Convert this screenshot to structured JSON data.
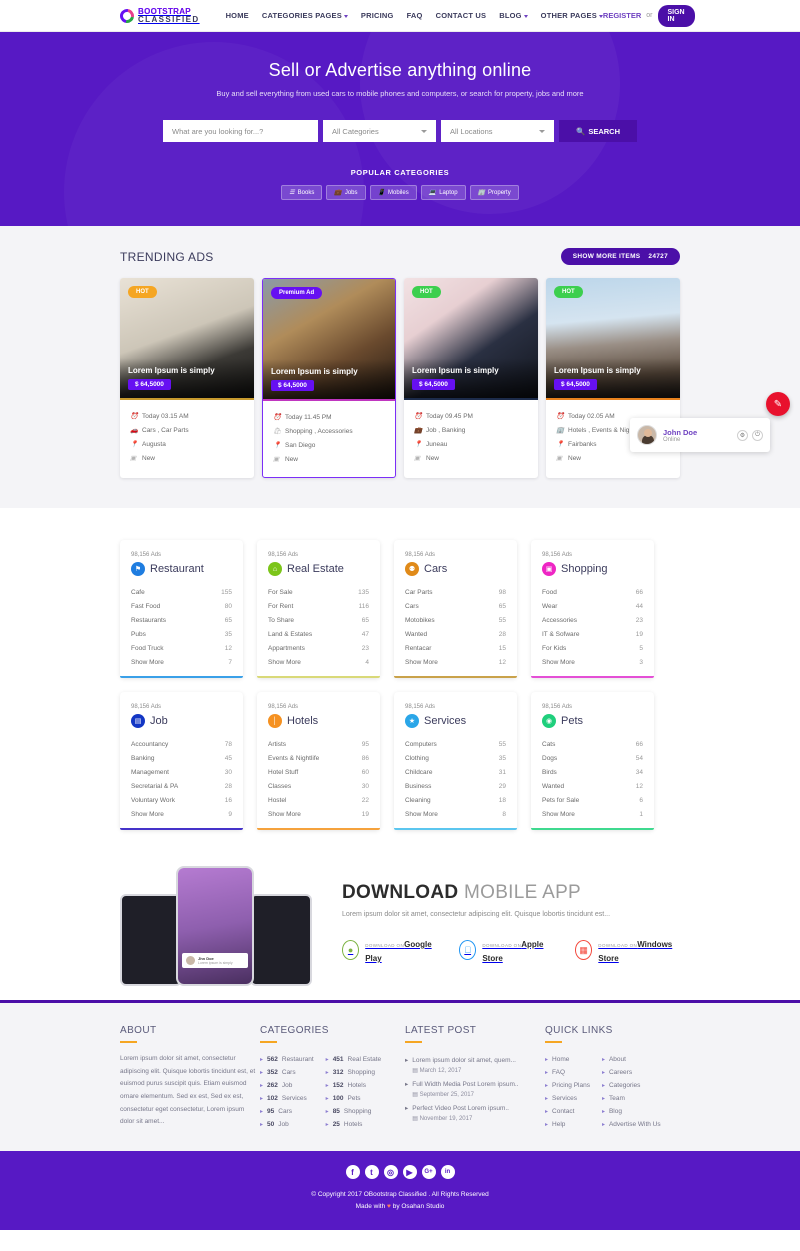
{
  "header": {
    "logo_line1": "BOOTSTRAP",
    "logo_line2": "CLASSIFIED",
    "nav": [
      {
        "label": "HOME",
        "caret": false
      },
      {
        "label": "CATEGORIES PAGES",
        "caret": true
      },
      {
        "label": "PRICING",
        "caret": false
      },
      {
        "label": "FAQ",
        "caret": false
      },
      {
        "label": "CONTACT US",
        "caret": false
      },
      {
        "label": "BLOG",
        "caret": true
      },
      {
        "label": "OTHER PAGES",
        "caret": true
      }
    ],
    "register_label": "REGISTER",
    "or_label": "or",
    "signin_label": "SIGN IN"
  },
  "hero": {
    "title": "Sell or Advertise anything online",
    "subtitle": "Buy and sell everything from used cars to mobile phones and computers, or search for property, jobs and more",
    "search_placeholder": "What are you looking for...?",
    "category_select": "All Categories",
    "location_select": "All Locations",
    "search_button": "SEARCH",
    "search_icon": "search-icon",
    "popular_title": "POPULAR CATEGORIES",
    "pills": [
      {
        "label": "Books",
        "icon": "book-icon"
      },
      {
        "label": "Jobs",
        "icon": "briefcase-icon"
      },
      {
        "label": "Mobiles",
        "icon": "mobile-icon"
      },
      {
        "label": "Laptop",
        "icon": "laptop-icon"
      },
      {
        "label": "Property",
        "icon": "building-icon"
      }
    ]
  },
  "trending": {
    "heading": "TRENDING ADS",
    "show_more_label": "SHOW MORE ITEMS",
    "show_more_count": "24727",
    "cards": [
      {
        "badge": "HOT",
        "badge_type": "hot-orange",
        "featured": false,
        "title": "Lorem Ipsum is simply",
        "price": "$ 64,5000",
        "accent": "#c79a2e",
        "meta": [
          {
            "icon": "clock-icon",
            "text": "Today 03.15 AM"
          },
          {
            "icon": "car-icon",
            "text": "Cars , Car Parts"
          },
          {
            "icon": "pin-icon",
            "text": "Augusta"
          },
          {
            "icon": "tag-icon",
            "text": "New"
          }
        ]
      },
      {
        "badge": "Premium Ad",
        "badge_type": "premium",
        "featured": true,
        "title": "Lorem Ipsum is simply",
        "price": "$ 64,5000",
        "accent": "#c036c0",
        "meta": [
          {
            "icon": "clock-icon",
            "text": "Today 11.45 PM"
          },
          {
            "icon": "bag-icon",
            "text": "Shopping , Accessories"
          },
          {
            "icon": "pin-icon",
            "text": "San Diego"
          },
          {
            "icon": "tag-icon",
            "text": "New"
          }
        ]
      },
      {
        "badge": "HOT",
        "badge_type": "hot-green",
        "featured": false,
        "title": "Lorem Ipsum is simply",
        "price": "$ 64,5000",
        "accent": "#1c2b4a",
        "meta": [
          {
            "icon": "clock-icon",
            "text": "Today 09.45 PM"
          },
          {
            "icon": "briefcase-icon",
            "text": "Job , Banking"
          },
          {
            "icon": "pin-icon",
            "text": "Juneau"
          },
          {
            "icon": "tag-icon",
            "text": "New"
          }
        ]
      },
      {
        "badge": "HOT",
        "badge_type": "hot-green",
        "featured": false,
        "title": "Lorem Ipsum is simply",
        "price": "$ 64,5000",
        "accent": "#e8821e",
        "meta": [
          {
            "icon": "clock-icon",
            "text": "Today 02.05 AM"
          },
          {
            "icon": "building-icon",
            "text": "Hotels , Events & Nig"
          },
          {
            "icon": "pin-icon",
            "text": "Fairbanks"
          },
          {
            "icon": "tag-icon",
            "text": "New"
          }
        ]
      }
    ]
  },
  "categories": [
    {
      "ads": "98,156 Ads",
      "name": "Restaurant",
      "icon": "restaurant-icon",
      "color": "#1f7de0",
      "bar": "#3aa0e8",
      "items": [
        {
          "label": "Cafe",
          "count": "155"
        },
        {
          "label": "Fast Food",
          "count": "80"
        },
        {
          "label": "Restaurants",
          "count": "65"
        },
        {
          "label": "Pubs",
          "count": "35"
        },
        {
          "label": "Food Truck",
          "count": "12"
        },
        {
          "label": "Show More",
          "count": "7"
        }
      ]
    },
    {
      "ads": "98,156 Ads",
      "name": "Real Estate",
      "icon": "home-icon",
      "color": "#7cc51a",
      "bar": "#d9d978",
      "items": [
        {
          "label": "For Sale",
          "count": "135"
        },
        {
          "label": "For Rent",
          "count": "116"
        },
        {
          "label": "To Share",
          "count": "65"
        },
        {
          "label": "Land & Estates",
          "count": "47"
        },
        {
          "label": "Appartments",
          "count": "23"
        },
        {
          "label": "Show More",
          "count": "4"
        }
      ]
    },
    {
      "ads": "98,156 Ads",
      "name": "Cars",
      "icon": "car-icon",
      "color": "#e08a19",
      "bar": "#c9a24a",
      "items": [
        {
          "label": "Car Parts",
          "count": "98"
        },
        {
          "label": "Cars",
          "count": "65"
        },
        {
          "label": "Motobikes",
          "count": "55"
        },
        {
          "label": "Wanted",
          "count": "28"
        },
        {
          "label": "Rentacar",
          "count": "15"
        },
        {
          "label": "Show More",
          "count": "12"
        }
      ]
    },
    {
      "ads": "98,156 Ads",
      "name": "Shopping",
      "icon": "bag-icon",
      "color": "#ee26c4",
      "bar": "#e44fd6",
      "items": [
        {
          "label": "Food",
          "count": "66"
        },
        {
          "label": "Wear",
          "count": "44"
        },
        {
          "label": "Accessories",
          "count": "23"
        },
        {
          "label": "IT & Sofware",
          "count": "19"
        },
        {
          "label": "For Kids",
          "count": "5"
        },
        {
          "label": "Show More",
          "count": "3"
        }
      ]
    },
    {
      "ads": "98,156 Ads",
      "name": "Job",
      "icon": "briefcase-icon",
      "color": "#1336c4",
      "bar": "#4533c9",
      "items": [
        {
          "label": "Accountancy",
          "count": "78"
        },
        {
          "label": "Banking",
          "count": "45"
        },
        {
          "label": "Management",
          "count": "30"
        },
        {
          "label": "Secretarial & PA",
          "count": "28"
        },
        {
          "label": "Voluntary Work",
          "count": "16"
        },
        {
          "label": "Show More",
          "count": "9"
        }
      ]
    },
    {
      "ads": "98,156 Ads",
      "name": "Hotels",
      "icon": "hotel-icon",
      "color": "#f59121",
      "bar": "#f5a23c",
      "items": [
        {
          "label": "Artists",
          "count": "95"
        },
        {
          "label": "Events & Nightlife",
          "count": "86"
        },
        {
          "label": "Hotel Stuff",
          "count": "60"
        },
        {
          "label": "Classes",
          "count": "30"
        },
        {
          "label": "Hostel",
          "count": "22"
        },
        {
          "label": "Show More",
          "count": "19"
        }
      ]
    },
    {
      "ads": "98,156 Ads",
      "name": "Services",
      "icon": "star-icon",
      "color": "#2aa6e8",
      "bar": "#5bc6ef",
      "items": [
        {
          "label": "Computers",
          "count": "55"
        },
        {
          "label": "Clothing",
          "count": "35"
        },
        {
          "label": "Childcare",
          "count": "31"
        },
        {
          "label": "Business",
          "count": "29"
        },
        {
          "label": "Cleaning",
          "count": "18"
        },
        {
          "label": "Show More",
          "count": "8"
        }
      ]
    },
    {
      "ads": "98,156 Ads",
      "name": "Pets",
      "icon": "paw-icon",
      "color": "#1fcf7c",
      "bar": "#3fd98f",
      "items": [
        {
          "label": "Cats",
          "count": "66"
        },
        {
          "label": "Dogs",
          "count": "54"
        },
        {
          "label": "Birds",
          "count": "34"
        },
        {
          "label": "Wanted",
          "count": "12"
        },
        {
          "label": "Pets for Sale",
          "count": "6"
        },
        {
          "label": "Show More",
          "count": "1"
        }
      ]
    }
  ],
  "app": {
    "title_bold": "DOWNLOAD",
    "title_light": "MOBILE APP",
    "desc": "Lorem ipsum dolor sit amet, consectetur adipiscing elit. Quisque lobortis tincidunt est...",
    "stores": [
      {
        "sup": "DOWNLOAD ON",
        "name": "Google Play",
        "icon": "android-icon",
        "color": "#7cb342"
      },
      {
        "sup": "DOWNLOAD ON",
        "name": "Apple Store",
        "icon": "apple-icon",
        "color": "#2196f3"
      },
      {
        "sup": "DOWNLOAD ON",
        "name": "Windows Store",
        "icon": "windows-icon",
        "color": "#f4483c"
      }
    ],
    "phone_center_name": "Jhn Doe",
    "phone_center_sub": "Lorem ipsum is simply"
  },
  "footer": {
    "about": {
      "title": "ABOUT",
      "text": "Lorem ipsum dolor sit amet, consectetur adipiscing elit. Quisque lobortis tincidunt est, et euismod purus suscipit quis. Etiam euismod ornare elementum. Sed ex est, Sed ex est, consectetur eget consectetur, Lorem ipsum dolor sit amet..."
    },
    "categories": {
      "title": "CATEGORIES",
      "col1": [
        {
          "count": "562",
          "label": "Restaurant"
        },
        {
          "count": "352",
          "label": "Cars"
        },
        {
          "count": "262",
          "label": "Job"
        },
        {
          "count": "102",
          "label": "Services"
        },
        {
          "count": "95",
          "label": "Cars"
        },
        {
          "count": "50",
          "label": "Job"
        }
      ],
      "col2": [
        {
          "count": "451",
          "label": "Real Estate"
        },
        {
          "count": "312",
          "label": "Shopping"
        },
        {
          "count": "152",
          "label": "Hotels"
        },
        {
          "count": "100",
          "label": "Pets"
        },
        {
          "count": "85",
          "label": "Shopping"
        },
        {
          "count": "25",
          "label": "Hotels"
        }
      ]
    },
    "latest": {
      "title": "LATEST POST",
      "posts": [
        {
          "text": "Lorem ipsum dolor sit amet, quem...",
          "date": "March 12, 2017"
        },
        {
          "text": "Full Width Media Post Lorem ipsum..",
          "date": "September 25, 2017"
        },
        {
          "text": "Perfect Video Post Lorem ipsum..",
          "date": "November 19, 2017"
        }
      ]
    },
    "quick": {
      "title": "QUICK LINKS",
      "col1": [
        "Home",
        "FAQ",
        "Pricing Plans",
        "Services",
        "Contact",
        "Help"
      ],
      "col2": [
        "About",
        "Careers",
        "Categories",
        "Team",
        "Blog",
        "Advertise With Us"
      ]
    }
  },
  "copyright": {
    "socials": [
      "facebook-icon",
      "twitter-icon",
      "dribbble-icon",
      "youtube-icon",
      "google-plus-icon",
      "linkedin-icon"
    ],
    "line1": "© Copyright 2017 OBootstrap Classified . All Rights Reserved",
    "line2_pre": "Made with",
    "line2_heart": "♥",
    "line2_post": "by Osahan Studio"
  },
  "chat": {
    "name": "John Doe",
    "status": "Online",
    "settings_icon": "gear-icon",
    "power_icon": "power-icon"
  },
  "fab": {
    "icon": "pencil-icon"
  }
}
